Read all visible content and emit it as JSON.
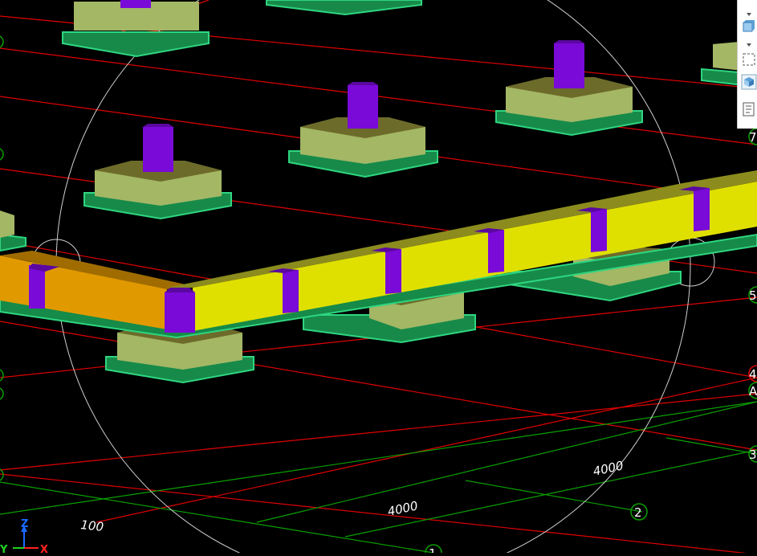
{
  "viewport": {
    "dimension_labels": [
      "100",
      "4000",
      "4000"
    ],
    "grid_bubbles": {
      "bottom": [
        "1",
        "2"
      ],
      "right": [
        "7",
        "5",
        "4",
        "A",
        "3"
      ]
    },
    "axis_triad": {
      "z": "Z",
      "y": "Y",
      "x": "X"
    },
    "colors": {
      "background": "#000000",
      "grid_line_red": "#e00000",
      "grid_line_green": "#0aa000",
      "footing_top": "#a3b765",
      "footing_side": "#8c9e55",
      "footing_base_edge": "#2ed680",
      "column": "#7a0ad8",
      "beam_yellow": "#e0e000",
      "beam_orange": "#e09a00",
      "orbit_circle": "#d0d0d0"
    }
  },
  "toolbar": {
    "buttons": [
      {
        "icon": "dropdown-arrow-icon"
      },
      {
        "icon": "view-cube-icon"
      },
      {
        "icon": "dropdown-arrow-icon"
      },
      {
        "icon": "selection-box-icon"
      },
      {
        "icon": "object-view-icon"
      },
      {
        "icon": "properties-list-icon"
      }
    ]
  }
}
